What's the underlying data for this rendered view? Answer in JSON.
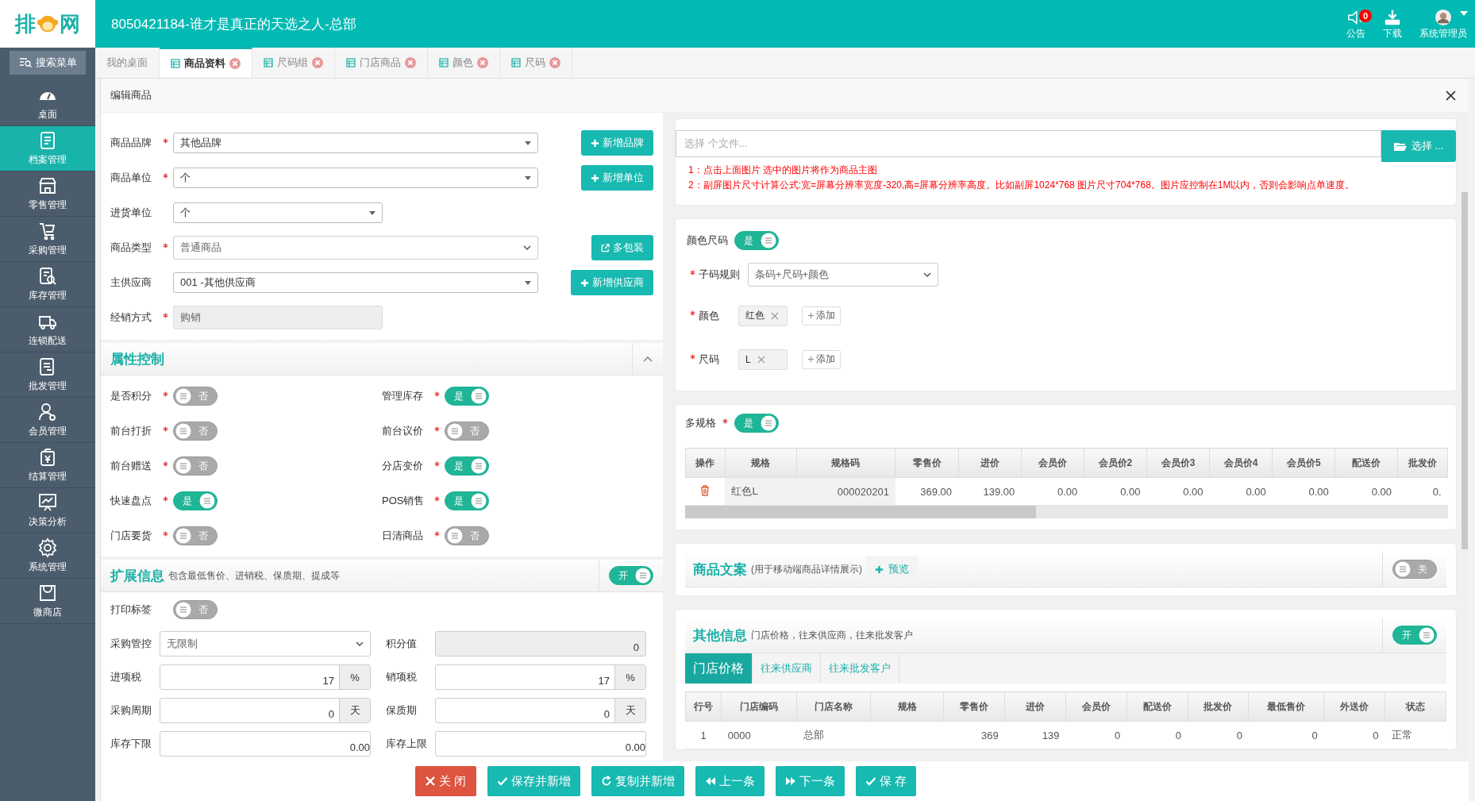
{
  "header": {
    "logo": {
      "before": "排",
      "after": "网"
    },
    "title": "8050421184-谁才是真正的天选之人-总部",
    "actions": [
      {
        "kind": "notice",
        "label": "公告",
        "badge": "0"
      },
      {
        "kind": "download",
        "label": "下载"
      },
      {
        "kind": "user",
        "label": "系统管理员"
      }
    ]
  },
  "sidebar": {
    "search": "搜索菜单",
    "items": [
      {
        "kind": "desk",
        "label": "桌面",
        "selected": false
      },
      {
        "kind": "archive",
        "label": "档案管理",
        "selected": true
      },
      {
        "kind": "store",
        "label": "零售管理",
        "selected": false
      },
      {
        "kind": "purchase",
        "label": "采购管理",
        "selected": false
      },
      {
        "kind": "stock",
        "label": "库存管理",
        "selected": false
      },
      {
        "kind": "delivery",
        "label": "连锁配送",
        "selected": false
      },
      {
        "kind": "wholesale",
        "label": "批发管理",
        "selected": false
      },
      {
        "kind": "member",
        "label": "会员管理",
        "selected": false
      },
      {
        "kind": "settle",
        "label": "结算管理",
        "selected": false
      },
      {
        "kind": "analysis",
        "label": "决策分析",
        "selected": false
      },
      {
        "kind": "system",
        "label": "系统管理",
        "selected": false
      },
      {
        "kind": "shop",
        "label": "微商店",
        "selected": false
      }
    ]
  },
  "tabs": [
    {
      "label": "我的桌面",
      "selected": false,
      "closable": false
    },
    {
      "label": "商品资料",
      "selected": true,
      "closable": true
    },
    {
      "label": "尺码组",
      "selected": false,
      "closable": true
    },
    {
      "label": "门店商品",
      "selected": false,
      "closable": true
    },
    {
      "label": "颜色",
      "selected": false,
      "closable": true
    },
    {
      "label": "尺码",
      "selected": false,
      "closable": true
    }
  ],
  "dialog": {
    "title": "编辑商品"
  },
  "basic_fields": [
    {
      "label": "商品品牌",
      "required": true,
      "kind": "combo",
      "value": "其他品牌",
      "button": {
        "kind": "add",
        "label": "新增品牌"
      }
    },
    {
      "label": "商品单位",
      "required": true,
      "kind": "combo",
      "value": "个",
      "button": {
        "kind": "add",
        "label": "新增单位"
      }
    },
    {
      "label": "进货单位",
      "required": false,
      "kind": "combo",
      "value": "个"
    },
    {
      "label": "商品类型",
      "required": true,
      "kind": "select",
      "value": "普通商品",
      "button": {
        "kind": "open",
        "label": "多包装"
      }
    },
    {
      "label": "主供应商",
      "required": false,
      "kind": "combo",
      "value": "001 -其他供应商",
      "button": {
        "kind": "add",
        "label": "新增供应商"
      }
    },
    {
      "label": "经销方式",
      "required": true,
      "kind": "readonly",
      "value": "购销"
    }
  ],
  "attribute_control": {
    "title": "属性控制",
    "expanded": true,
    "toggles": [
      {
        "label": "是否积分",
        "required": true,
        "on": false,
        "text": "否"
      },
      {
        "label": "管理库存",
        "required": true,
        "on": true,
        "text": "是"
      },
      {
        "label": "前台打折",
        "required": true,
        "on": false,
        "text": "否"
      },
      {
        "label": "前台议价",
        "required": true,
        "on": false,
        "text": "否"
      },
      {
        "label": "前台赠送",
        "required": true,
        "on": false,
        "text": "否"
      },
      {
        "label": "分店变价",
        "required": true,
        "on": true,
        "text": "是"
      },
      {
        "label": "快速盘点",
        "required": true,
        "on": true,
        "text": "是"
      },
      {
        "label": "POS销售",
        "required": true,
        "on": true,
        "text": "是"
      },
      {
        "label": "门店要货",
        "required": true,
        "on": false,
        "text": "否"
      },
      {
        "label": "日清商品",
        "required": true,
        "on": false,
        "text": "否"
      }
    ]
  },
  "extended_info": {
    "title": "扩展信息",
    "subtitle": "包含最低售价、进销税、保质期、提成等",
    "toggle": {
      "on": true,
      "text": "开"
    },
    "print_label": {
      "label": "打印标签",
      "on": false,
      "text": "否"
    },
    "fields": [
      {
        "label": "采购管控",
        "kind": "select",
        "value": "无限制"
      },
      {
        "label": "积分值",
        "kind": "readonly",
        "value": "0"
      },
      {
        "label": "进项税",
        "kind": "number",
        "value": "17",
        "unit": "%"
      },
      {
        "label": "销项税",
        "kind": "number",
        "value": "17",
        "unit": "%"
      },
      {
        "label": "采购周期",
        "kind": "number",
        "value": "0",
        "unit": "天"
      },
      {
        "label": "保质期",
        "kind": "number",
        "value": "0",
        "unit": "天"
      },
      {
        "label": "库存下限",
        "kind": "number",
        "value": "0.00"
      },
      {
        "label": "库存上限",
        "kind": "number",
        "value": "0.00"
      }
    ]
  },
  "image_upload": {
    "placeholder": "选择 个文件...",
    "button": "选择 ...",
    "notes": [
      "1：点击上面图片 选中的图片将作为商品主图",
      "2：副屏图片尺寸计算公式:宽=屏幕分辨率宽度-320,高=屏幕分辨率高度。比如副屏1024*768 图片尺寸704*768。图片应控制在1M以内，否则会影响点单速度。"
    ]
  },
  "color_size": {
    "label": "颜色尺码",
    "toggle": {
      "on": true,
      "text": "是"
    },
    "rule": {
      "label": "子码规则",
      "value": "条码+尺码+颜色"
    },
    "groups": [
      {
        "label": "颜色",
        "tags": [
          "红色"
        ],
        "add": "添加"
      },
      {
        "label": "尺码",
        "tags": [
          "L"
        ],
        "add": "添加"
      }
    ]
  },
  "multi_spec": {
    "label": "多规格",
    "toggle": {
      "on": true,
      "text": "是"
    },
    "columns": [
      "操作",
      "规格",
      "规格码",
      "零售价",
      "进价",
      "会员价",
      "会员价2",
      "会员价3",
      "会员价4",
      "会员价5",
      "配送价",
      "批发价"
    ],
    "rows": [
      {
        "cells": [
          "",
          "红色L",
          "000020201",
          "369.00",
          "139.00",
          "0.00",
          "0.00",
          "0.00",
          "0.00",
          "0.00",
          "0.00",
          "0."
        ]
      }
    ]
  },
  "product_copy": {
    "title": "商品文案",
    "subtitle": "(用于移动端商品详情展示)",
    "preview": "预览",
    "toggle": {
      "on": false,
      "text": "关"
    }
  },
  "other_info": {
    "title": "其他信息",
    "subtitle": "门店价格，往来供应商，往来批发客户",
    "toggle": {
      "on": true,
      "text": "开"
    },
    "tabs": [
      {
        "label": "门店价格",
        "selected": true
      },
      {
        "label": "往来供应商",
        "selected": false
      },
      {
        "label": "往来批发客户",
        "selected": false
      }
    ],
    "columns": [
      "行号",
      "门店编码",
      "门店名称",
      "规格",
      "零售价",
      "进价",
      "会员价",
      "配送价",
      "批发价",
      "最低售价",
      "外送价",
      "状态"
    ],
    "rows": [
      {
        "cells": [
          "1",
          "0000",
          "总部",
          "",
          "369",
          "139",
          "0",
          "0",
          "0",
          "0",
          "0",
          "正常"
        ]
      }
    ]
  },
  "footer_buttons": [
    {
      "kind": "close",
      "label": "关 闭"
    },
    {
      "kind": "save_new",
      "label": "保存并新增"
    },
    {
      "kind": "copy_new",
      "label": "复制并新增"
    },
    {
      "kind": "prev",
      "label": "上一条"
    },
    {
      "kind": "next",
      "label": "下一条"
    },
    {
      "kind": "save",
      "label": "保 存"
    }
  ]
}
